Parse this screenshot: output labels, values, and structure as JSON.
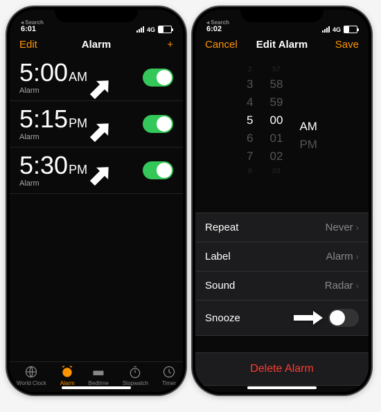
{
  "left": {
    "status": {
      "time": "6:01",
      "search": "Search",
      "network": "4G"
    },
    "nav": {
      "left": "Edit",
      "title": "Alarm",
      "right": "+"
    },
    "alarms": [
      {
        "time": "5:00",
        "ampm": "AM",
        "label": "Alarm",
        "on": true
      },
      {
        "time": "5:15",
        "ampm": "PM",
        "label": "Alarm",
        "on": true
      },
      {
        "time": "5:30",
        "ampm": "PM",
        "label": "Alarm",
        "on": true
      }
    ],
    "tabs": [
      {
        "label": "World Clock"
      },
      {
        "label": "Alarm"
      },
      {
        "label": "Bedtime"
      },
      {
        "label": "Stopwatch"
      },
      {
        "label": "Timer"
      }
    ]
  },
  "right": {
    "status": {
      "time": "6:02",
      "search": "Search",
      "network": "4G"
    },
    "nav": {
      "left": "Cancel",
      "title": "Edit Alarm",
      "right": "Save"
    },
    "picker": {
      "hours": [
        "2",
        "3",
        "4",
        "5",
        "6",
        "7",
        "8"
      ],
      "mins": [
        "57",
        "58",
        "59",
        "00",
        "01",
        "02",
        "03"
      ],
      "ampm": [
        "AM",
        "PM"
      ]
    },
    "rows": {
      "repeat": {
        "label": "Repeat",
        "value": "Never"
      },
      "label": {
        "label": "Label",
        "value": "Alarm"
      },
      "sound": {
        "label": "Sound",
        "value": "Radar"
      },
      "snooze": {
        "label": "Snooze"
      }
    },
    "delete": "Delete Alarm"
  }
}
